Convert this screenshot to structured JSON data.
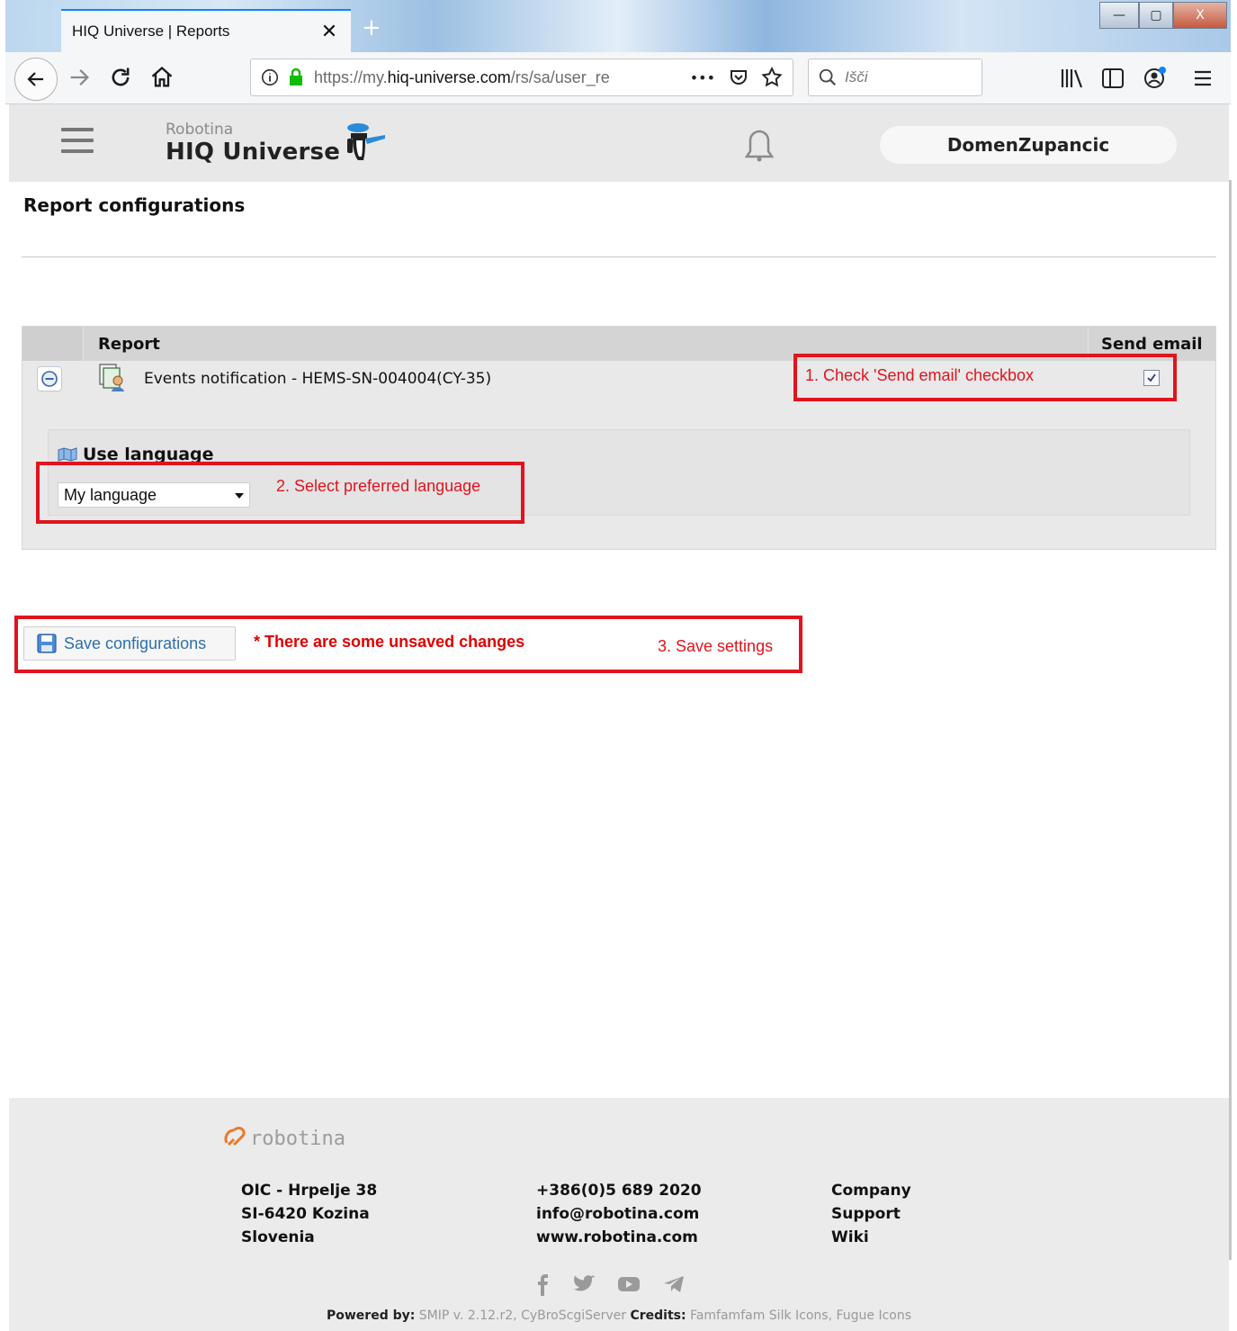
{
  "browser": {
    "tab_title": "HIQ Universe | Reports",
    "tab_close": "✕",
    "new_tab": "+",
    "url_prefix": "https://my.",
    "url_domain": "hiq-universe.com",
    "url_path": "/rs/sa/user_re",
    "url_more": "•••",
    "search_placeholder": "Išči",
    "win_min": "—",
    "win_max": "▢",
    "win_close": "X"
  },
  "header": {
    "brand_small": "Robotina",
    "brand_big": "HIQ Universe",
    "username": "DomenZupancic"
  },
  "page": {
    "title": "Report configurations"
  },
  "report_table": {
    "col_report": "Report",
    "col_send_email": "Send email",
    "rows": [
      {
        "name": "Events notification - HEMS-SN-004004(CY-35)",
        "send_email": true
      }
    ]
  },
  "language": {
    "title": "Use language",
    "selected": "My language"
  },
  "actions": {
    "save_label": "Save configurations",
    "unsaved_notice": "* There are some unsaved changes"
  },
  "annotations": {
    "step1": "1. Check 'Send email' checkbox",
    "step2": "2. Select preferred language",
    "step3": "3. Save settings",
    "color": "#e0141e"
  },
  "footer": {
    "logo_text": "robotina",
    "address": [
      "OIC - Hrpelje 38",
      "SI-6420 Kozina",
      "Slovenia"
    ],
    "contact": [
      "+386(0)5 689 2020",
      "info@robotina.com",
      "www.robotina.com"
    ],
    "links": [
      "Company",
      "Support",
      "Wiki"
    ],
    "powered_label": "Powered by:",
    "powered_value": "SMIP v. 2.12.r2, CyBroScgiServer",
    "credits_label": "Credits:",
    "credits_value": "Famfamfam Silk Icons, Fugue Icons"
  }
}
